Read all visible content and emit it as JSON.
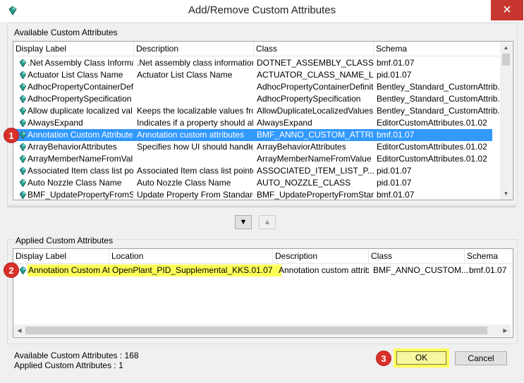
{
  "window": {
    "title": "Add/Remove Custom Attributes",
    "close_glyph": "✕"
  },
  "available": {
    "group_label": "Available Custom Attributes",
    "columns": [
      "Display Label",
      "Description",
      "Class",
      "Schema"
    ],
    "rows": [
      {
        "label": ".Net Assembly Class Informat...",
        "description": ".Net assembly class information",
        "class": "DOTNET_ASSEMBLY_CLASS...",
        "schema": "bmf.01.07"
      },
      {
        "label": "Actuator List Class Name",
        "description": "Actuator List Class Name",
        "class": "ACTUATOR_CLASS_NAME_L...",
        "schema": "pid.01.07"
      },
      {
        "label": "AdhocPropertyContainerDefi...",
        "description": "",
        "class": "AdhocPropertyContainerDefiniti...",
        "schema": "Bentley_Standard_CustomAttrib..."
      },
      {
        "label": "AdhocPropertySpecification",
        "description": "",
        "class": "AdhocPropertySpecification",
        "schema": "Bentley_Standard_CustomAttrib..."
      },
      {
        "label": "Allow duplicate localized val...",
        "description": "Keeps the localizable values fro...",
        "class": "AllowDuplicateLocalizedValues",
        "schema": "Bentley_Standard_CustomAttrib..."
      },
      {
        "label": "AlwaysExpand",
        "description": "Indicates if a property should al...",
        "class": "AlwaysExpand",
        "schema": "EditorCustomAttributes.01.02"
      },
      {
        "label": "Annotation Custom Attributes",
        "description": "Annotation custom attributes",
        "class": "BMF_ANNO_CUSTOM_ATTRI...",
        "schema": "bmf.01.07"
      },
      {
        "label": "ArrayBehaviorAttributes",
        "description": "Specifies how UI should handle...",
        "class": "ArrayBehaviorAttributes",
        "schema": "EditorCustomAttributes.01.02"
      },
      {
        "label": "ArrayMemberNameFromValue",
        "description": "",
        "class": "ArrayMemberNameFromValue",
        "schema": "EditorCustomAttributes.01.02"
      },
      {
        "label": "Associated Item class list poi...",
        "description": "Associated Item class list pointer",
        "class": "ASSOCIATED_ITEM_LIST_P...",
        "schema": "pid.01.07"
      },
      {
        "label": "Auto Nozzle Class Name",
        "description": "Auto Nozzle Class Name",
        "class": "AUTO_NOZZLE_CLASS",
        "schema": "pid.01.07"
      },
      {
        "label": "BMF_UpdatePropertyFromSt...",
        "description": "Update Property From Standard...",
        "class": "BMF_UpdatePropertyFromStan...",
        "schema": "bmf.01.07"
      }
    ]
  },
  "move_buttons": {
    "down_glyph": "▼",
    "up_glyph": "▲"
  },
  "applied": {
    "group_label": "Applied Custom Attributes",
    "columns": [
      "Display Label",
      "Location",
      "Description",
      "Class",
      "Schema"
    ],
    "rows": [
      {
        "label": "Annotation Custom At...",
        "location": "OpenPlant_PID_Supplemental_KKS.01.07",
        "description": "Annotation custom attrib...",
        "class": "BMF_ANNO_CUSTOM...",
        "schema": "bmf.01.07"
      }
    ]
  },
  "status": {
    "available_count": "Available Custom Attributes : 168",
    "applied_count": "Applied Custom Attributes : 1"
  },
  "buttons": {
    "ok": "OK",
    "cancel": "Cancel"
  },
  "callouts": [
    "1",
    "2",
    "3"
  ],
  "colors": {
    "selection": "#3399ff",
    "highlight": "#ffff5a",
    "callout": "#d9302a",
    "close": "#c7372f"
  },
  "icons": {
    "app": "gem-icon",
    "row": "gem-icon"
  }
}
